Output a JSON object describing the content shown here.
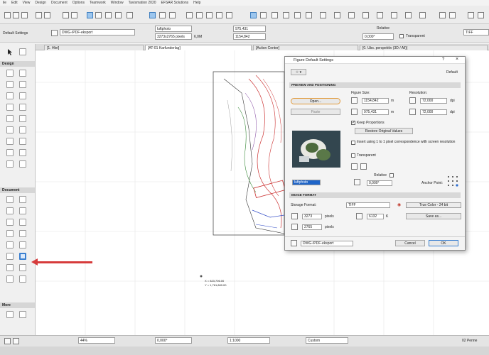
{
  "menu": [
    "ile",
    "Edit",
    "View",
    "Design",
    "Document",
    "Options",
    "Teamwork",
    "Window",
    "Tavismation 2020",
    "EFSAR Solutions",
    "Help"
  ],
  "toolbar": {
    "settings_label": "Default Settings",
    "translator": "DWG-/PDF-eksport",
    "figure_name": "luftphoto",
    "size_text": "3273x2765 pixels",
    "file_size": "6,0M",
    "coord_a": "975,431",
    "coord_b": "1154,842",
    "relative_label": "Relative",
    "angle": "0,000°",
    "transparent_label": "Transparent",
    "format": "TIFF"
  },
  "tabs": [
    "[1. Hlet]",
    "[AT-01 Karfunderlag]",
    "[Action Center]",
    "[0. Ubs. perspektiv (3D / All)]"
  ],
  "toolbox": {
    "design": "Design",
    "document": "Document",
    "more": "More"
  },
  "coords": {
    "x": "X = 823,706.00",
    "y": "Y = 1,761,889.00"
  },
  "dialog": {
    "title": "Figure Default Settings",
    "default_label": "Default",
    "sec_preview": "PREVIEW AND POSITIONING",
    "open_btn": "Open...",
    "paste_btn": "Paste",
    "figure_size_label": "Figure Size:",
    "resolution_label": "Resolution:",
    "width": "1154,842",
    "height": "975,431",
    "unit": "m",
    "res1": "72,000",
    "res2": "72,000",
    "dpi": "dpi",
    "keep_proportions": "Keep Proportions",
    "restore_btn": "Restore Original Values",
    "insert_label": "Insert using 1 to 1 pixel correspondence with screen resolution",
    "transparent_label": "Transparent",
    "relative_label": "Relative",
    "angle": "0,000°",
    "anchor_label": "Anchor Point:",
    "filename": "luftphoto",
    "sec_image": "IMAGE FORMAT",
    "storage_label": "Storage Format:",
    "storage_value": "TIFF",
    "color_value": "True Color - 24 bit",
    "pixels_w": "3273",
    "pixels_h": "2765",
    "pixels_unit": "pixels",
    "kb": "6132",
    "kb_unit": "K",
    "save_btn": "Save as...",
    "translator": "DWG-/PDF-eksport",
    "cancel_btn": "Cancel",
    "ok_btn": "OK"
  },
  "status": {
    "zoom": "44%",
    "angle": "0,000°",
    "scale": "1:1000",
    "custom": "Custom",
    "right": "02 Penne"
  }
}
